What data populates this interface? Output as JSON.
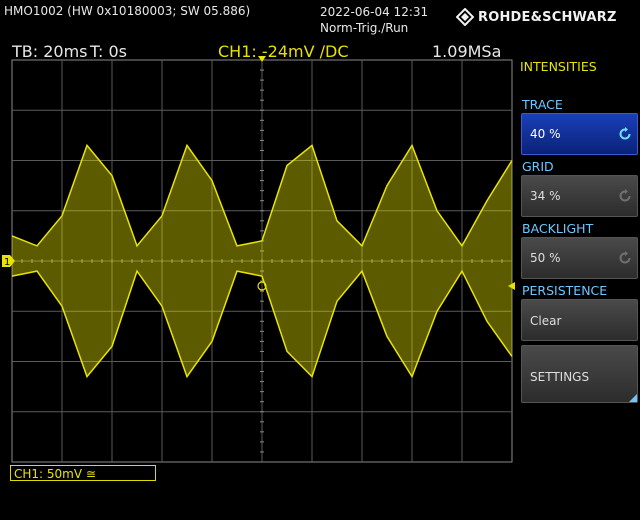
{
  "header": {
    "model": "HMO1002 (HW 0x10180003; SW 05.886)",
    "date": "2022-06-04 12:31",
    "trigger_mode": "Norm-Trig./Run",
    "brand": "ROHDE&SCHWARZ"
  },
  "infobar": {
    "timebase": "TB: 20ms",
    "trigger_time": "T: 0s",
    "channel": "CH1: -24mV ∕DC",
    "sample_rate": "1.09MSa"
  },
  "scope": {
    "channel_marker": "1",
    "trace_color": "#e8e400",
    "grid_color": "#5a5a5a",
    "chart_data": {
      "type": "line",
      "ylim": [
        -4,
        4
      ],
      "xlim": [
        -5,
        5
      ],
      "grid": true,
      "envelope": {
        "x": [
          -5,
          -4.5,
          -4,
          -3.5,
          -3,
          -2.5,
          -2,
          -1.5,
          -1,
          -0.5,
          0,
          0.5,
          1,
          1.5,
          2,
          2.5,
          3,
          3.5,
          4,
          4.5,
          5
        ],
        "upper": [
          0.5,
          0.3,
          0.9,
          2.3,
          1.7,
          0.3,
          0.9,
          2.3,
          1.6,
          0.3,
          0.4,
          1.9,
          2.3,
          0.8,
          0.3,
          1.5,
          2.3,
          1.0,
          0.3,
          1.2,
          2.0
        ],
        "lower": [
          -0.3,
          -0.2,
          -0.9,
          -2.3,
          -1.7,
          -0.2,
          -0.9,
          -2.3,
          -1.6,
          -0.2,
          -0.3,
          -1.8,
          -2.3,
          -0.8,
          -0.2,
          -1.5,
          -2.3,
          -1.0,
          -0.2,
          -1.2,
          -1.9
        ]
      }
    }
  },
  "footer": {
    "ch_scale": "CH1: 50mV ≅"
  },
  "menu": {
    "title": "INTENSITIES",
    "trace_label": "TRACE",
    "trace_value": "40 %",
    "grid_label": "GRID",
    "grid_value": "34 %",
    "backlight_label": "BACKLIGHT",
    "backlight_value": "50 %",
    "persistence_label": "PERSISTENCE",
    "clear_label": "Clear",
    "settings_label": "SETTINGS",
    "accent": "#6ec8ff",
    "active_color": "#1a3fb8"
  }
}
